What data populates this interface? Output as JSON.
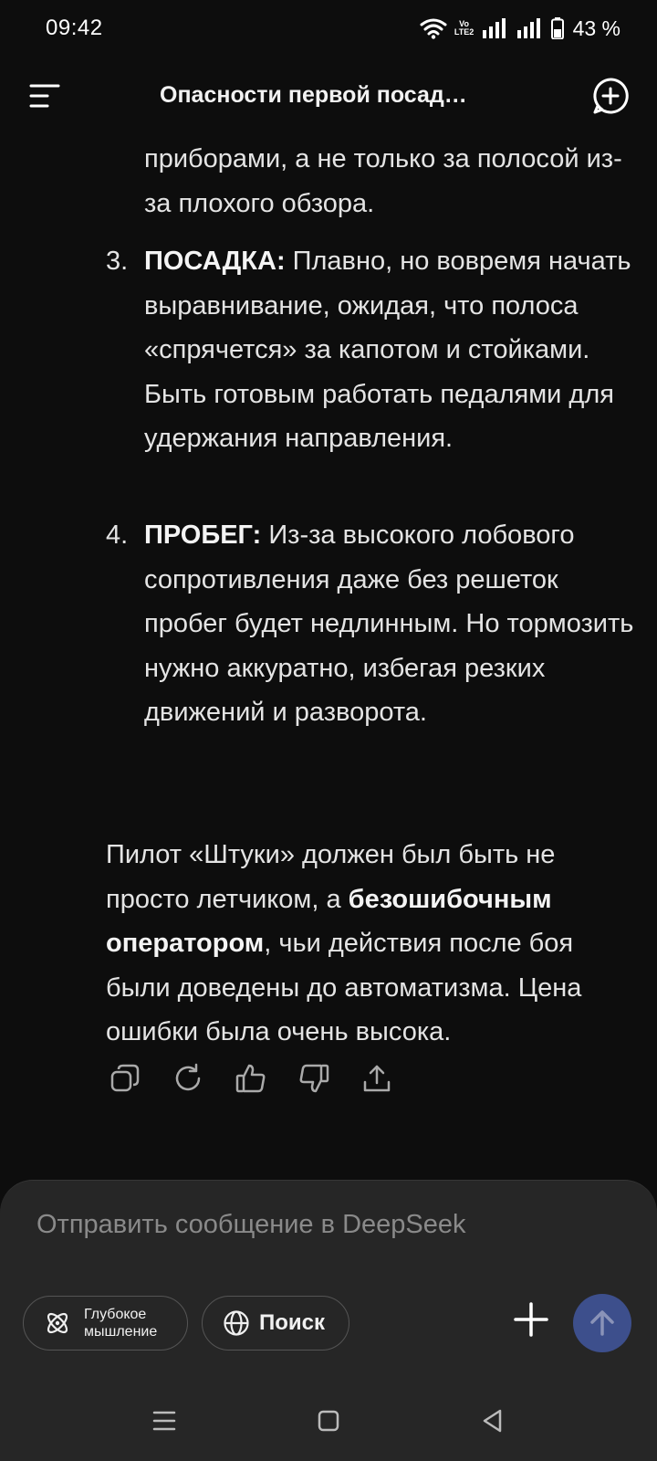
{
  "status_bar": {
    "time": "09:42",
    "volte_top": "Vo",
    "volte_bottom": "LTE2",
    "battery": "43 %"
  },
  "header": {
    "title": "Опасности первой посад…",
    "menu_icon": "menu-icon",
    "new_chat_icon": "new-chat-icon"
  },
  "message": {
    "cont_text": "приборами, а не только за полосой из-за плохого обзора.",
    "items": [
      {
        "number": "3.",
        "heading": "ПОСАДКА:",
        "text": " Плавно, но вовремя начать выравнивание, ожидая, что полоса «спрячется» за капотом и стойками. Быть готовым работать педалями для удержания направления."
      },
      {
        "number": "4.",
        "heading": "ПРОБЕГ:",
        "text": " Из-за высокого лобового сопротивления даже без решеток пробег будет недлинным. Но тормозить нужно аккуратно, избегая резких движений и разворота."
      }
    ],
    "conclusion": {
      "before": "Пилот «Штуки» должен был быть не просто летчиком, а ",
      "bold": "безошибочным оператором",
      "after": ", чьи действия после боя были доведены до автоматизма. Цена ошибки была очень высока."
    }
  },
  "actions": [
    "copy-icon",
    "regenerate-icon",
    "thumbs-up-icon",
    "thumbs-down-icon",
    "share-icon"
  ],
  "composer": {
    "placeholder": "Отправить сообщение в DeepSeek",
    "deep_think_line1": "Глубокое",
    "deep_think_line2": "мышление",
    "search_label": "Поиск"
  },
  "colors": {
    "background": "#0d0d0d",
    "composer_bg": "#262626",
    "send_button": "#3d4f8c",
    "text": "#e4e4e4"
  }
}
